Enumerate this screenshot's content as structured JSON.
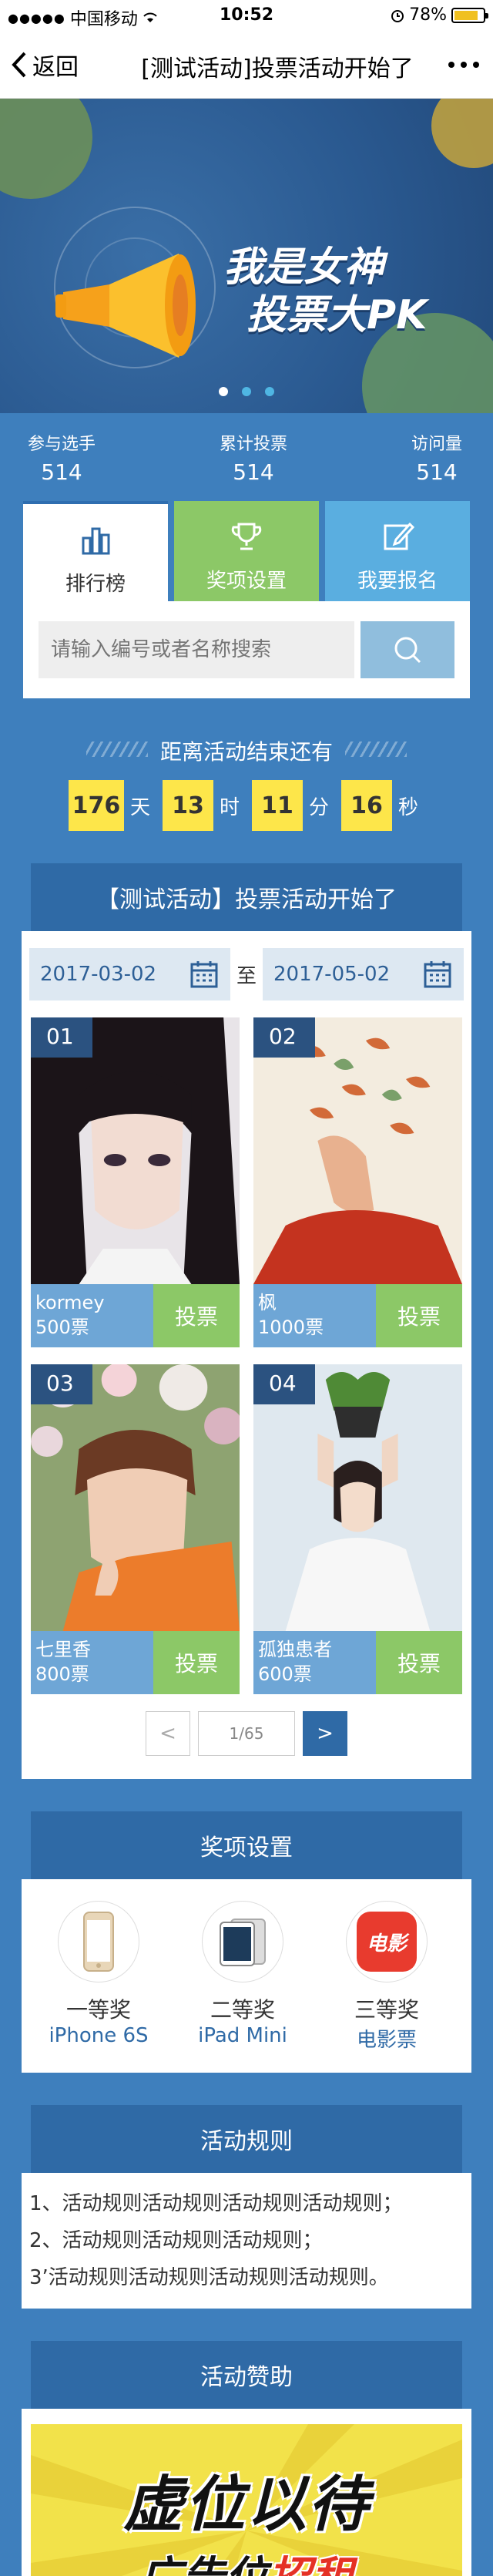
{
  "status_bar": {
    "carrier": "中国移动",
    "time": "10:52",
    "battery": "78%"
  },
  "navbar": {
    "back_label": "返回",
    "title": "[测试活动]投票活动开始了"
  },
  "banner": {
    "headline_line1": "我是女神",
    "headline_line2": "投票大PK",
    "slide_count": 3,
    "active_slide": 1
  },
  "stats": [
    {
      "label": "参与选手",
      "value": "514"
    },
    {
      "label": "累计投票",
      "value": "514"
    },
    {
      "label": "访问量",
      "value": "514"
    }
  ],
  "tabs": [
    {
      "label": "排行榜",
      "icon": "bar-chart-icon"
    },
    {
      "label": "奖项设置",
      "icon": "trophy-icon"
    },
    {
      "label": "我要报名",
      "icon": "edit-icon"
    }
  ],
  "search": {
    "placeholder": "请输入编号或者名称搜索"
  },
  "countdown": {
    "title": "距离活动结束还有",
    "days": "176",
    "days_unit": "天",
    "hours": "13",
    "hours_unit": "时",
    "minutes": "11",
    "minutes_unit": "分",
    "seconds": "16",
    "seconds_unit": "秒"
  },
  "activity": {
    "title": "【测试活动】投票活动开始了",
    "start_date": "2017-03-02",
    "to_label": "至",
    "end_date": "2017-05-02"
  },
  "contestants": [
    {
      "num": "01",
      "name": "kormey",
      "votes": "500票",
      "vote_label": "投票"
    },
    {
      "num": "02",
      "name": "枫",
      "votes": "1000票",
      "vote_label": "投票"
    },
    {
      "num": "03",
      "name": "七里香",
      "votes": "800票",
      "vote_label": "投票"
    },
    {
      "num": "04",
      "name": "孤独患者",
      "votes": "600票",
      "vote_label": "投票"
    }
  ],
  "pager": {
    "prev": "<",
    "page": "1/65",
    "next": ">"
  },
  "prizes": {
    "title": "奖项设置",
    "items": [
      {
        "rank": "一等奖",
        "name": "iPhone 6S"
      },
      {
        "rank": "二等奖",
        "name": "iPad Mini"
      },
      {
        "rank": "三等奖",
        "name": "电影票",
        "logo": "电影"
      }
    ]
  },
  "rules": {
    "title": "活动规则",
    "lines": [
      "1、活动规则活动规则活动规则活动规则；",
      "2、活动规则活动规则活动规则；",
      "3’活动规则活动规则活动规则活动规则。"
    ]
  },
  "sponsor": {
    "title": "活动赞助",
    "ad_line1": "虚位以待",
    "ad_line2_a": "广告位",
    "ad_line2_b": "招租"
  },
  "colors": {
    "page_bg": "#3e7fbd",
    "panel_head": "#2f6aa6",
    "green": "#8cc867",
    "yellow": "#fde64a"
  }
}
